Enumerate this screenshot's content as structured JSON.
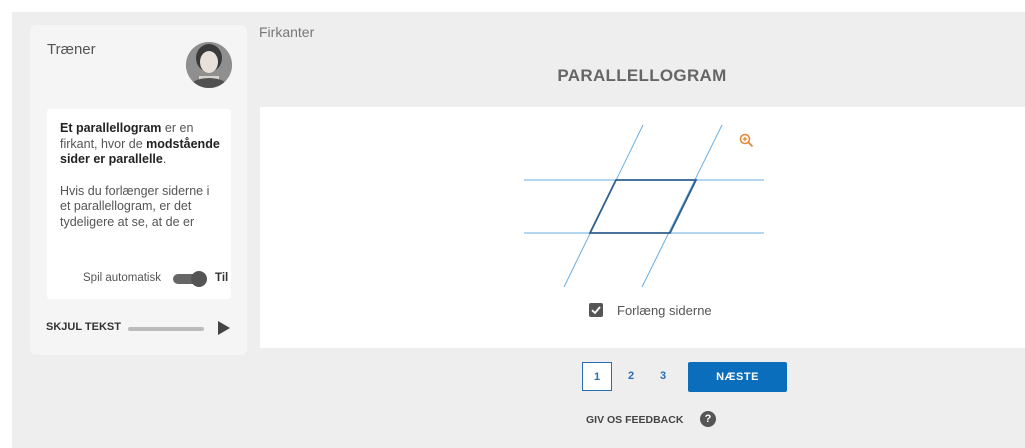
{
  "trainer": {
    "title": "Træner",
    "text": {
      "p1_bold1": "Et parallellogram",
      "p1_text1": " er en firkant, hvor de ",
      "p1_bold2": "modstående sider er parallelle",
      "p1_text2": ".",
      "p2": "Hvis du forlænger siderne i et parallellogram, er det tydeligere at se, at de er"
    },
    "autoplay_label": "Spil automatisk",
    "autoplay_state": "Til",
    "hide_text_label": "SKJUL TEKST"
  },
  "breadcrumb": "Firkanter",
  "page_title": "PARALLELLOGRAM",
  "exercise": {
    "checkbox_label": "Forlæng siderne",
    "checkbox_checked": true
  },
  "pagination": {
    "pages": [
      "1",
      "2",
      "3"
    ],
    "current": "1",
    "next_label": "NÆSTE"
  },
  "feedback_label": "GIV OS FEEDBACK",
  "colors": {
    "primary": "#0a6ebd",
    "zoom_icon": "#e08a3c",
    "extension_lines": "#6aaee0",
    "shape_stroke": "#2f5f8f"
  },
  "icons": {
    "zoom": "zoom-in-icon",
    "help": "help-icon",
    "play": "play-icon",
    "check": "check-icon"
  }
}
